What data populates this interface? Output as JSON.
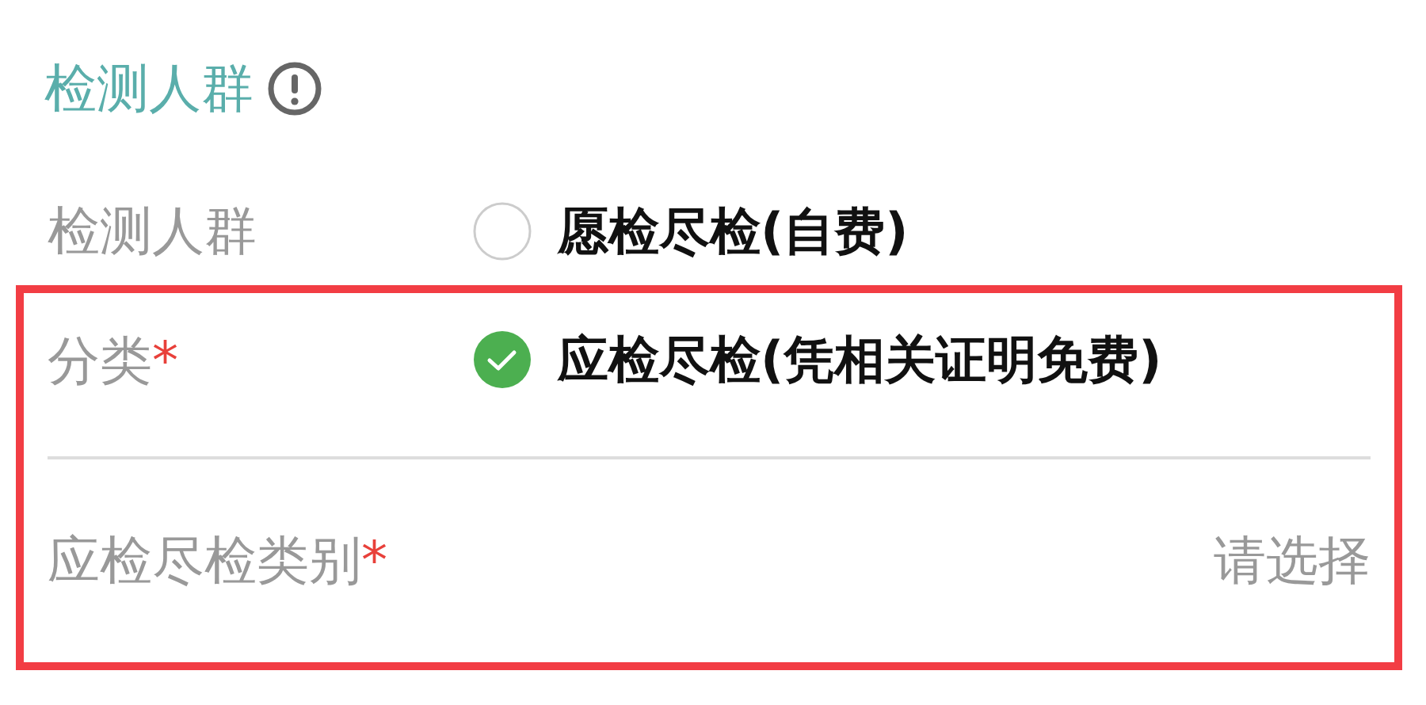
{
  "section": {
    "title": "检测人群"
  },
  "rows": [
    {
      "kind": "radio",
      "label": "检测人群",
      "option": {
        "text": "愿检尽检(自费)",
        "selected": false
      }
    },
    {
      "kind": "radio",
      "label": "分类",
      "required_mark": "*",
      "highlighted": true,
      "option": {
        "text": "应检尽检(凭相关证明免费)",
        "selected": true
      }
    },
    {
      "kind": "select",
      "label": "应检尽检类别",
      "required_mark": "*",
      "highlighted": true,
      "placeholder": "请选择"
    }
  ]
}
